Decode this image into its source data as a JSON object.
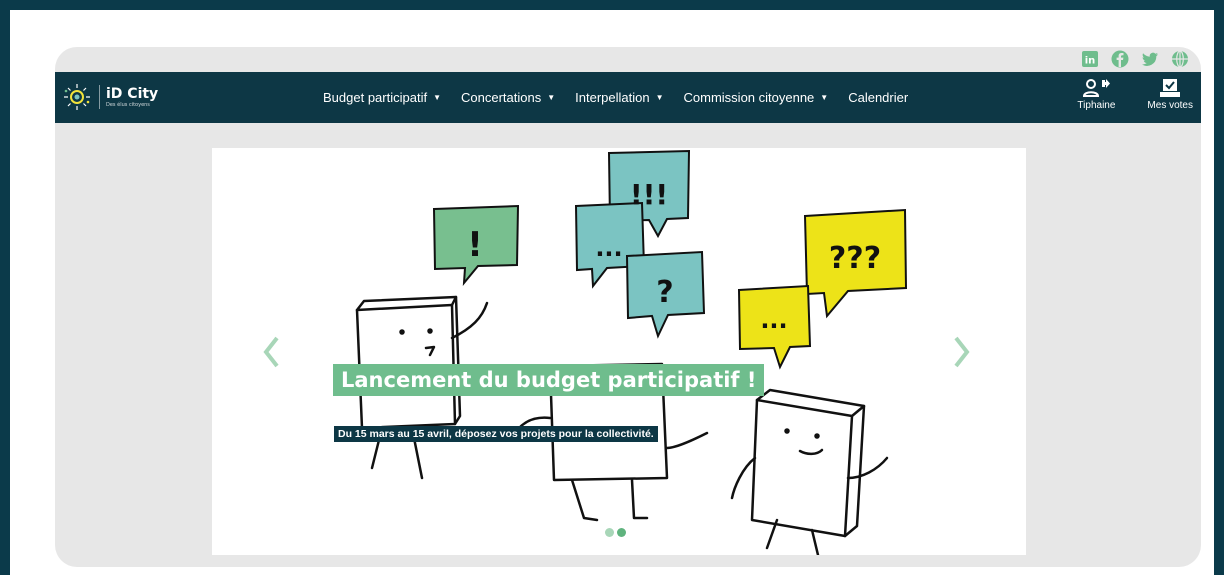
{
  "social": {
    "icons": [
      "linkedin-icon",
      "facebook-icon",
      "twitter-icon",
      "globe-icon"
    ],
    "color": "#6fbd8d"
  },
  "brand": {
    "name": "iD City",
    "tagline": "Des élus citoyens"
  },
  "nav": {
    "items": [
      {
        "label": "Budget participatif",
        "dropdown": true
      },
      {
        "label": "Concertations",
        "dropdown": true
      },
      {
        "label": "Interpellation",
        "dropdown": true
      },
      {
        "label": "Commission citoyenne",
        "dropdown": true
      },
      {
        "label": "Calendrier",
        "dropdown": false
      }
    ],
    "user_label": "Tiphaine",
    "votes_label": "Mes votes"
  },
  "slider": {
    "title": "Lancement du budget participatif !",
    "subtitle": "Du 15 mars au 15 avril, déposez vos projets pour la collectivité.",
    "total_slides": 2,
    "active_slide": 2,
    "bubbles": {
      "green": "!",
      "teal_top": "!!!",
      "teal_left": "...",
      "teal_bottom": "?",
      "yellow_top": "???",
      "yellow_left": "..."
    }
  },
  "colors": {
    "navbar": "#0d3745",
    "accent_green": "#6fbd8d",
    "bubble_teal": "#7bc4c2",
    "bubble_yellow": "#ede318",
    "bubble_green": "#78bf8f"
  }
}
